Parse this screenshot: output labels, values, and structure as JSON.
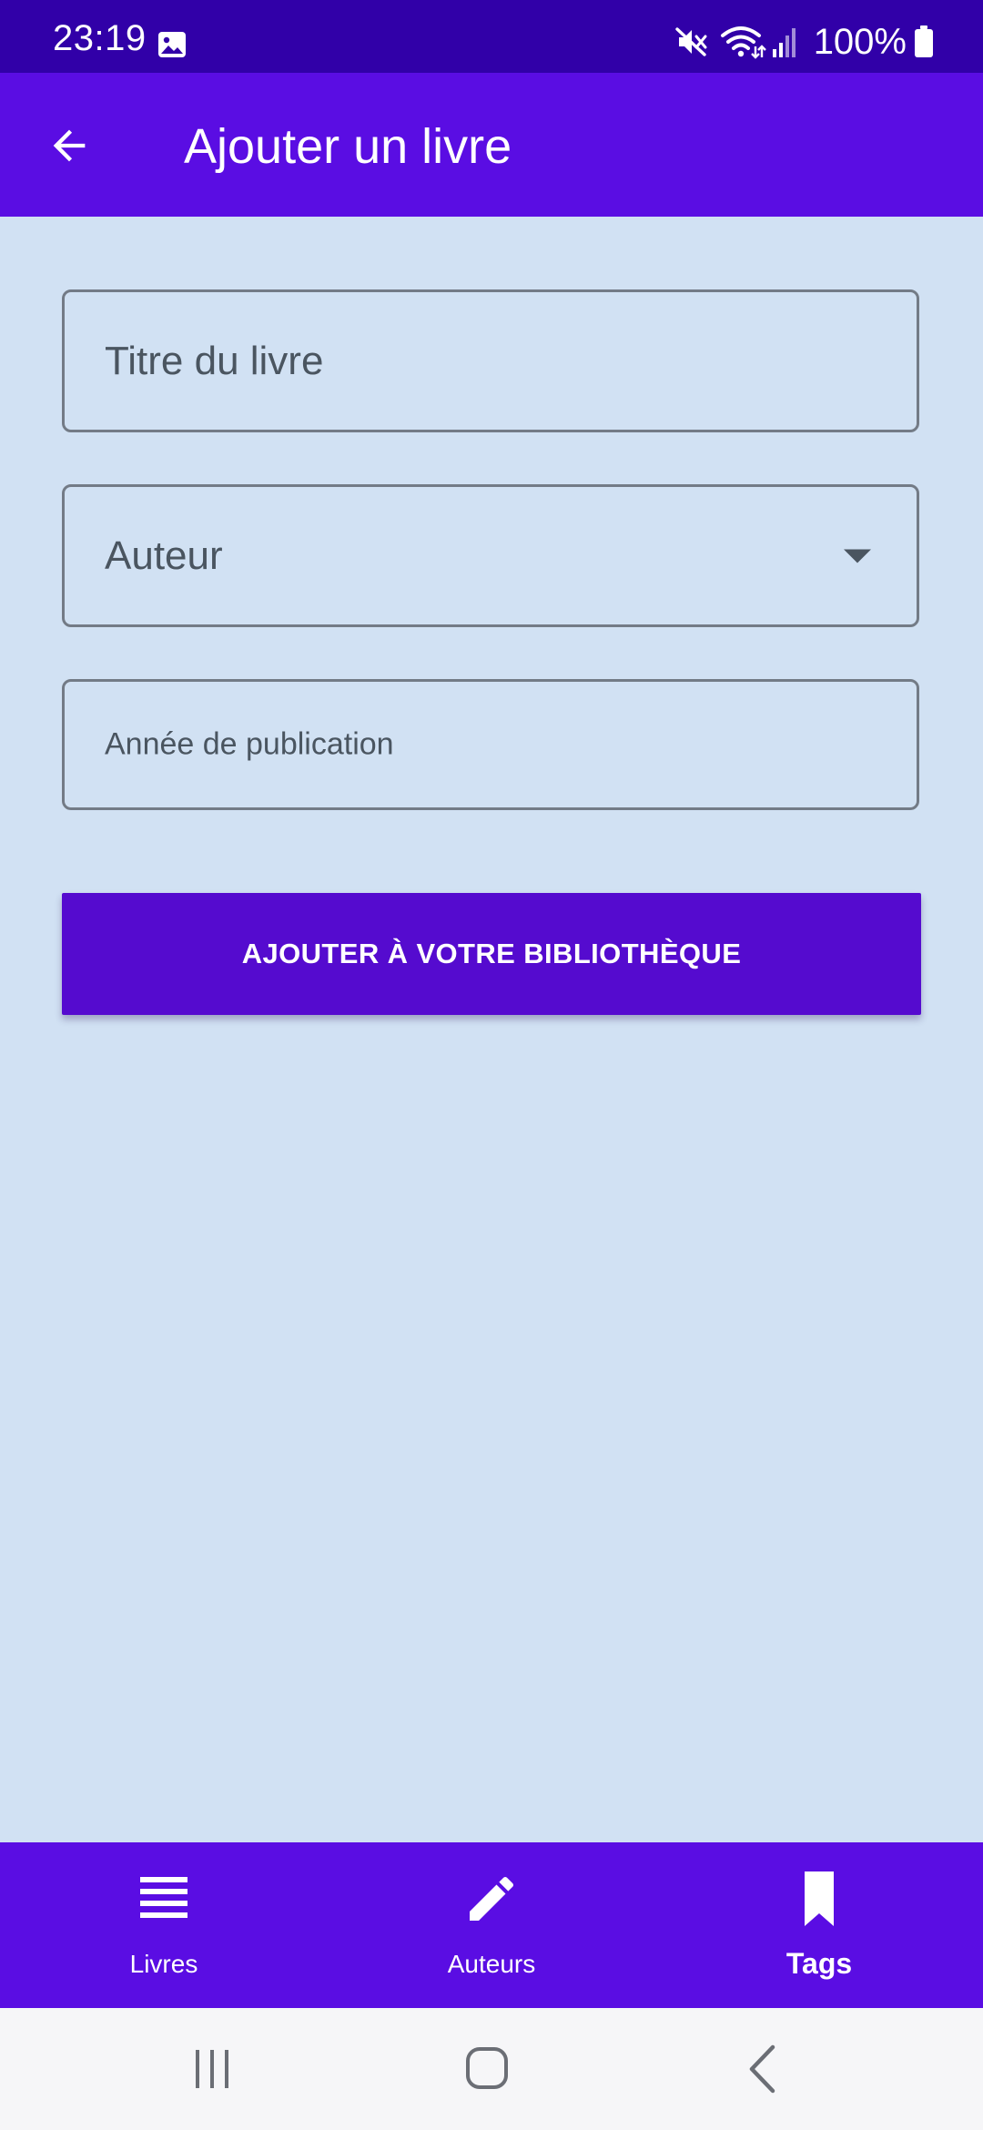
{
  "status_bar": {
    "time": "23:19",
    "battery_percent": "100%",
    "icons": [
      "gallery-icon",
      "mute-icon",
      "wifi-icon",
      "signal-icon",
      "battery-icon"
    ]
  },
  "app_bar": {
    "title": "Ajouter un livre",
    "back_icon": "arrow-back-icon"
  },
  "form": {
    "title_placeholder": "Titre du livre",
    "author_placeholder": "Auteur",
    "author_selected_value": "",
    "year_placeholder": "Année de publication",
    "submit_label": "AJOUTER À VOTRE BIBLIOTHÈQUE"
  },
  "bottom_nav": {
    "items": [
      {
        "label": "Livres",
        "icon": "list-icon",
        "selected": false
      },
      {
        "label": "Auteurs",
        "icon": "pencil-icon",
        "selected": false
      },
      {
        "label": "Tags",
        "icon": "bookmark-icon",
        "selected": true
      }
    ]
  },
  "system_nav": {
    "buttons": [
      "recents-icon",
      "home-icon",
      "back-chevron-icon"
    ]
  },
  "colors": {
    "status_bar": "#3100a8",
    "primary": "#5a0de3",
    "button": "#550bcf",
    "background": "#d1e1f3",
    "field_border": "#737b86",
    "system_nav": "#f6f6f8"
  }
}
